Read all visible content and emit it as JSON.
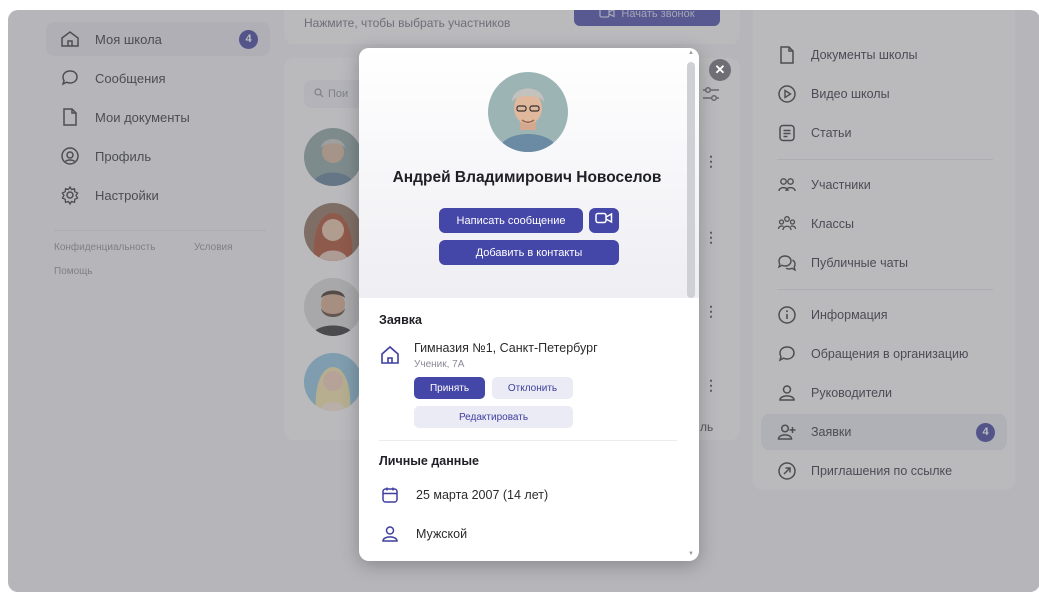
{
  "left_nav": {
    "items": [
      {
        "label": "Моя школа",
        "badge": "4",
        "icon": "school-icon"
      },
      {
        "label": "Сообщения",
        "icon": "chat-icon"
      },
      {
        "label": "Мои документы",
        "icon": "document-icon"
      },
      {
        "label": "Профиль",
        "icon": "profile-icon"
      },
      {
        "label": "Настройки",
        "icon": "gear-icon"
      }
    ],
    "footer": {
      "privacy": "Конфиденциальность",
      "terms": "Условия",
      "help": "Помощь"
    }
  },
  "middle": {
    "hint": "Нажмите, чтобы выбрать участников",
    "call_button": "Начать звонок",
    "search_placeholder": "Пои",
    "cut_text": "ль"
  },
  "right_nav": {
    "items": [
      {
        "label": "Документы школы",
        "icon": "document-icon"
      },
      {
        "label": "Видео школы",
        "icon": "play-icon"
      },
      {
        "label": "Статьи",
        "icon": "article-icon"
      },
      {
        "label": "Участники",
        "icon": "participants-icon"
      },
      {
        "label": "Классы",
        "icon": "classes-icon"
      },
      {
        "label": "Публичные чаты",
        "icon": "public-chats-icon"
      },
      {
        "label": "Информация",
        "icon": "info-icon"
      },
      {
        "label": "Обращения в организацию",
        "icon": "chat-icon"
      },
      {
        "label": "Руководители",
        "icon": "person-icon"
      },
      {
        "label": "Заявки",
        "badge": "4",
        "icon": "add-person-icon"
      },
      {
        "label": "Приглашения по ссылке",
        "icon": "link-arrow-icon"
      }
    ]
  },
  "modal": {
    "name": "Андрей Владимирович Новоселов",
    "message_button": "Написать сообщение",
    "contacts_button": "Добавить в контакты",
    "request": {
      "title": "Заявка",
      "school": "Гимназия №1, Санкт-Петербург",
      "role": "Ученик, 7А",
      "accept": "Принять",
      "decline": "Отклонить",
      "edit": "Редактировать"
    },
    "personal": {
      "title": "Личные данные",
      "birthdate": "25 марта 2007 (14 лет)",
      "gender": "Мужской"
    }
  },
  "colors": {
    "accent": "#4547a8",
    "overlay": "#6e6e73"
  }
}
